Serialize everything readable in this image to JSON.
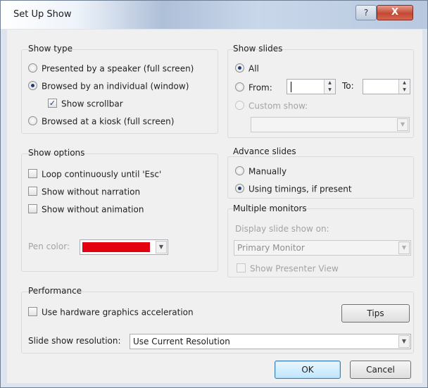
{
  "window": {
    "title": "Set Up Show",
    "help_label": "?",
    "close_label": "X"
  },
  "show_type": {
    "title": "Show type",
    "options": [
      {
        "label": "Presented by a speaker (full screen)",
        "selected": false
      },
      {
        "label": "Browsed by an individual (window)",
        "selected": true
      },
      {
        "label": "Browsed at a kiosk (full screen)",
        "selected": false
      }
    ],
    "show_scrollbar": {
      "label": "Show scrollbar",
      "checked": true
    }
  },
  "show_slides": {
    "title": "Show slides",
    "all_label": "All",
    "from_label": "From:",
    "to_label": "To:",
    "from_value": "",
    "to_value": "",
    "custom_label": "Custom show:",
    "custom_value": ""
  },
  "show_options": {
    "title": "Show options",
    "items": [
      {
        "label": "Loop continuously until 'Esc'",
        "checked": false
      },
      {
        "label": "Show without narration",
        "checked": false
      },
      {
        "label": "Show without animation",
        "checked": false
      }
    ],
    "pen_color_label": "Pen color:",
    "pen_color": "#e3000f"
  },
  "advance_slides": {
    "title": "Advance slides",
    "manually_label": "Manually",
    "timings_label": "Using timings, if present",
    "selected": "timings"
  },
  "multiple_monitors": {
    "title": "Multiple monitors",
    "display_on_label": "Display slide show on:",
    "monitor_value": "Primary Monitor",
    "presenter_view_label": "Show Presenter View"
  },
  "performance": {
    "title": "Performance",
    "hw_accel_label": "Use hardware graphics acceleration",
    "tips_label": "Tips",
    "resolution_label": "Slide show resolution:",
    "resolution_value": "Use Current Resolution"
  },
  "buttons": {
    "ok_label": "OK",
    "cancel_label": "Cancel"
  },
  "colors": {
    "titlebar_accent": "#aebfd8",
    "close_button": "#c24a35",
    "window_frame": "#dde4ee"
  }
}
